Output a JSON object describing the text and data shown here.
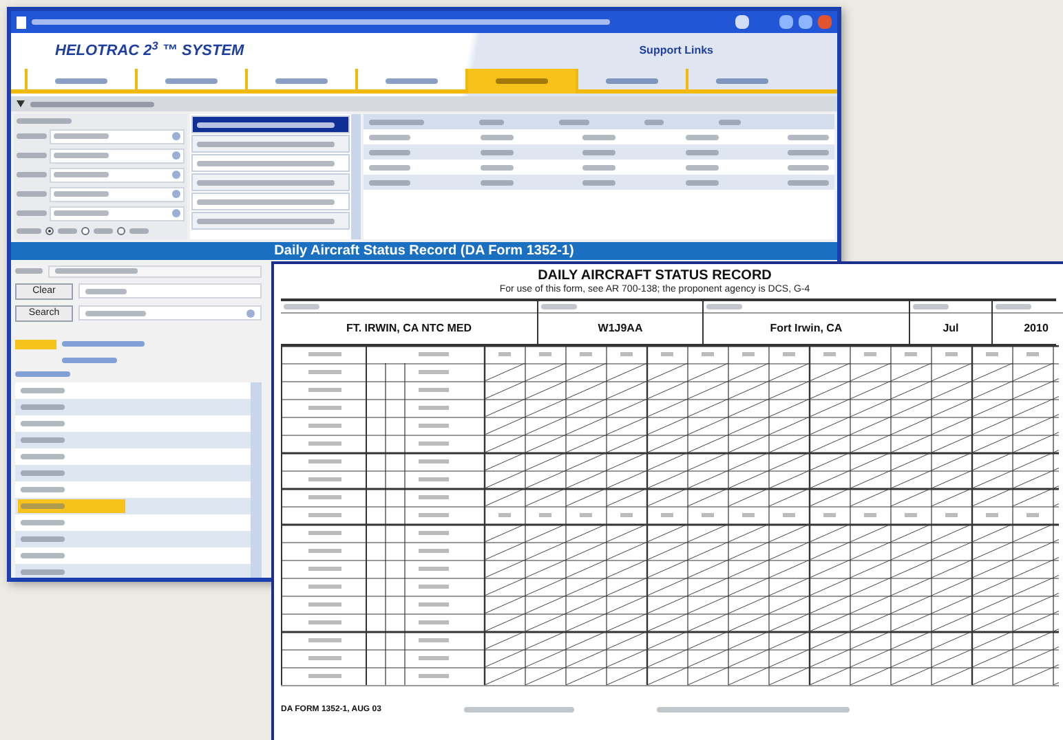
{
  "app": {
    "logo": "HELOTRAC 2$^{3}$ ™ SYSTEM",
    "support_link": "Support Links"
  },
  "nav_tabs": [
    {
      "selected": false
    },
    {
      "selected": false
    },
    {
      "selected": false
    },
    {
      "selected": false
    },
    {
      "selected": true
    },
    {
      "selected": false
    },
    {
      "selected": false
    }
  ],
  "aircraft_list": [
    {
      "selected": true
    },
    {
      "selected": false
    },
    {
      "selected": false
    },
    {
      "selected": false
    },
    {
      "selected": false
    },
    {
      "selected": false
    }
  ],
  "sort_options": [
    {
      "selected": true
    },
    {
      "selected": false
    },
    {
      "selected": false
    }
  ],
  "section_banner": "Daily Aircraft Status Record (DA Form 1352-1)",
  "buttons": [
    "Clear",
    "Search"
  ],
  "report_dates": [
    {
      "selected": false
    },
    {
      "selected": false
    },
    {
      "selected": false
    },
    {
      "selected": false
    },
    {
      "selected": false
    },
    {
      "selected": false
    },
    {
      "selected": false
    },
    {
      "selected": true
    },
    {
      "selected": false
    },
    {
      "selected": false
    },
    {
      "selected": false
    },
    {
      "selected": false
    }
  ],
  "form": {
    "title": "DAILY AIRCRAFT STATUS RECORD",
    "subtitle": "For use of this form, see AR 700-138; the proponent agency is DCS, G-4",
    "unit": "FT. IRWIN, CA NTC MED",
    "uic": "W1J9AA",
    "location": "Fort Irwin, CA",
    "month": "Jul",
    "year": "2010",
    "form_number": "DA FORM 1352-1, AUG 03"
  }
}
